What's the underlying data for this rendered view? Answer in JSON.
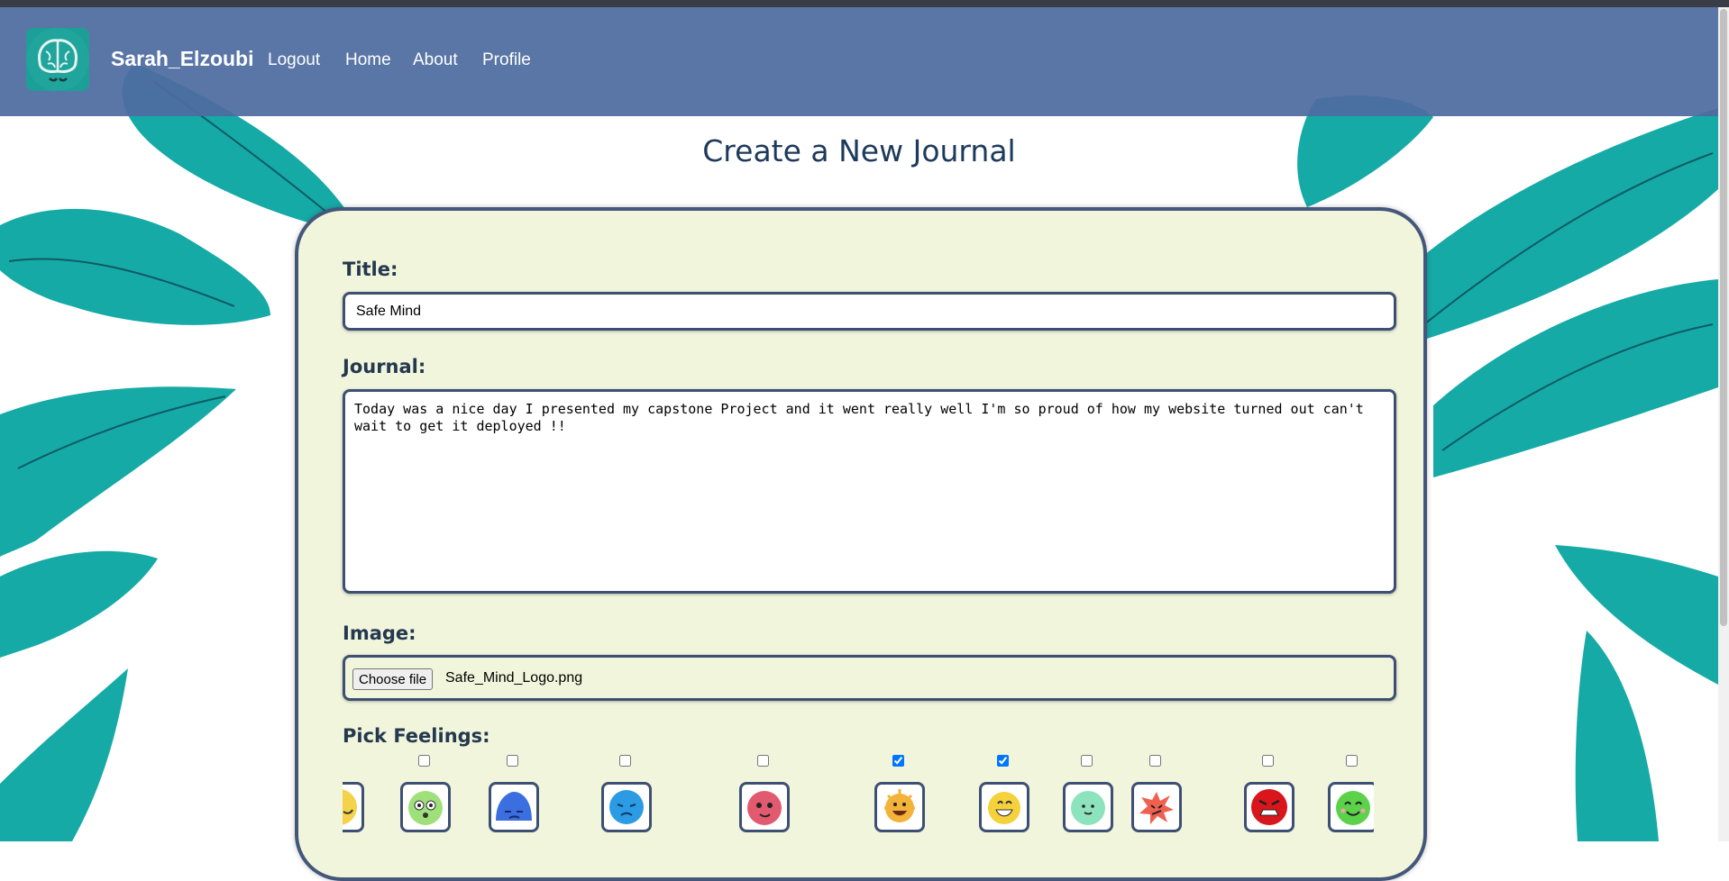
{
  "app": {
    "username": "Sarah_Elzoubi",
    "nav_links": [
      "Logout",
      "Home",
      "About",
      "Profile"
    ]
  },
  "page": {
    "title": "Create a New Journal"
  },
  "form": {
    "title_label": "Title:",
    "title_value": "Safe Mind",
    "journal_label": "Journal:",
    "journal_value": "Today was a nice day I presented my capstone Project and it went really well I'm so proud of how my website turned out can't wait to get it deployed !!",
    "image_label": "Image:",
    "file_button": "Choose file",
    "file_name": "Safe_Mind_Logo.png",
    "feelings_label": "Pick Feelings:"
  },
  "feelings": [
    {
      "icon": "yellow-partial-face-icon",
      "color": "#f4d24a",
      "checked": false
    },
    {
      "icon": "green-dizzy-face-icon",
      "color": "#9fe07a",
      "checked": false
    },
    {
      "icon": "blue-sleepy-blob-icon",
      "color": "#3b6fe0",
      "checked": false
    },
    {
      "icon": "blue-worried-face-icon",
      "color": "#2b9be3",
      "checked": false
    },
    {
      "icon": "pink-fuzzy-face-icon",
      "color": "#e25a70",
      "checked": false
    },
    {
      "icon": "orange-spiky-grin-icon",
      "color": "#f3b23a",
      "checked": true
    },
    {
      "icon": "yellow-sun-smile-icon",
      "color": "#f5d23c",
      "checked": true
    },
    {
      "icon": "mint-calm-face-icon",
      "color": "#8ee3bf",
      "checked": false
    },
    {
      "icon": "red-splat-angry-icon",
      "color": "#f0604f",
      "checked": false
    },
    {
      "icon": "red-furious-face-icon",
      "color": "#d8161c",
      "checked": false
    },
    {
      "icon": "green-happy-face-icon",
      "color": "#5bd24a",
      "checked": false
    }
  ],
  "colors": {
    "navbar": "#4e6ca0",
    "card_background": "#f1f5dc",
    "leaf": "#16aaa6",
    "heading": "#1d3a5c"
  }
}
